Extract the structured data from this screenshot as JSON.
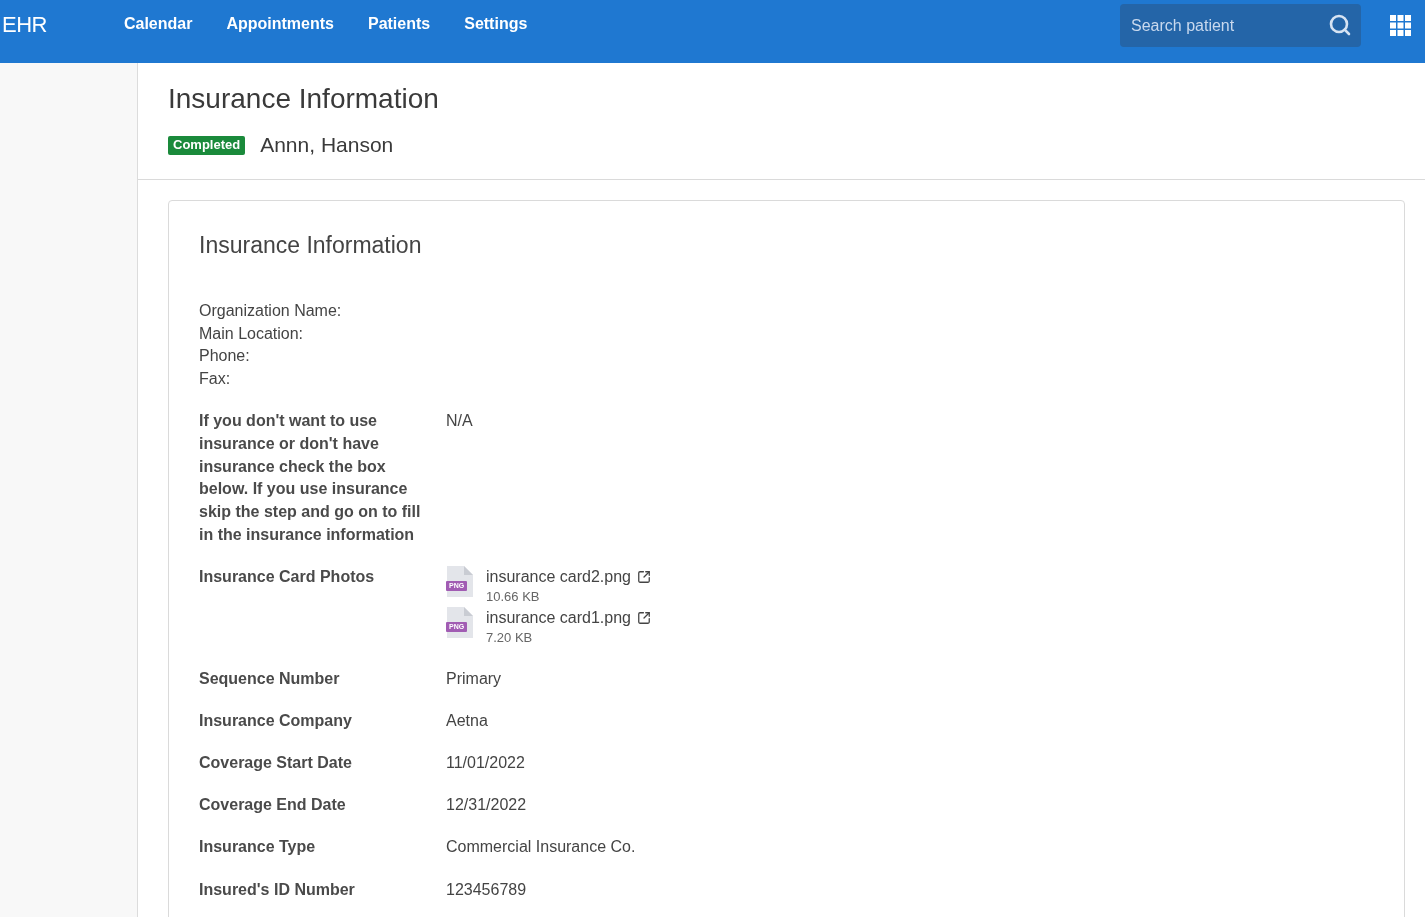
{
  "topbar": {
    "brand": "EHR",
    "nav": [
      {
        "label": "Calendar",
        "selected": false
      },
      {
        "label": "Appointments",
        "selected": false
      },
      {
        "label": "Patients",
        "selected": false
      },
      {
        "label": "Settings",
        "selected": false
      }
    ],
    "search": {
      "placeholder": "Search patient"
    }
  },
  "header": {
    "title": "Insurance Information",
    "status": {
      "label": "Completed",
      "kind": "success"
    },
    "patient_name": "Annn, Hanson"
  },
  "card": {
    "title": "Insurance Information",
    "organization": [
      "Organization Name:",
      "Main Location:",
      "Phone:",
      "Fax:"
    ],
    "fields": [
      {
        "kind": "text",
        "label": "If you don't want to use insurance or don't have insurance check the box below. If you use insurance skip the step and go on to fill in the insurance information",
        "value": "N/A"
      },
      {
        "kind": "files",
        "label": "Insurance Card Photos",
        "files": [
          {
            "name": "insurance card2.png",
            "type": "PNG",
            "size": "10.66 KB"
          },
          {
            "name": "insurance card1.png",
            "type": "PNG",
            "size": "7.20 KB"
          }
        ]
      },
      {
        "kind": "text",
        "label": "Sequence Number",
        "value": "Primary"
      },
      {
        "kind": "text",
        "label": "Insurance Company",
        "value": "Aetna"
      },
      {
        "kind": "text",
        "label": "Coverage Start Date",
        "value": "11/01/2022"
      },
      {
        "kind": "text",
        "label": "Coverage End Date",
        "value": "12/31/2022"
      },
      {
        "kind": "text",
        "label": "Insurance Type",
        "value": "Commercial Insurance Co."
      },
      {
        "kind": "text",
        "label": "Insured's ID Number",
        "value": "123456789"
      }
    ]
  }
}
